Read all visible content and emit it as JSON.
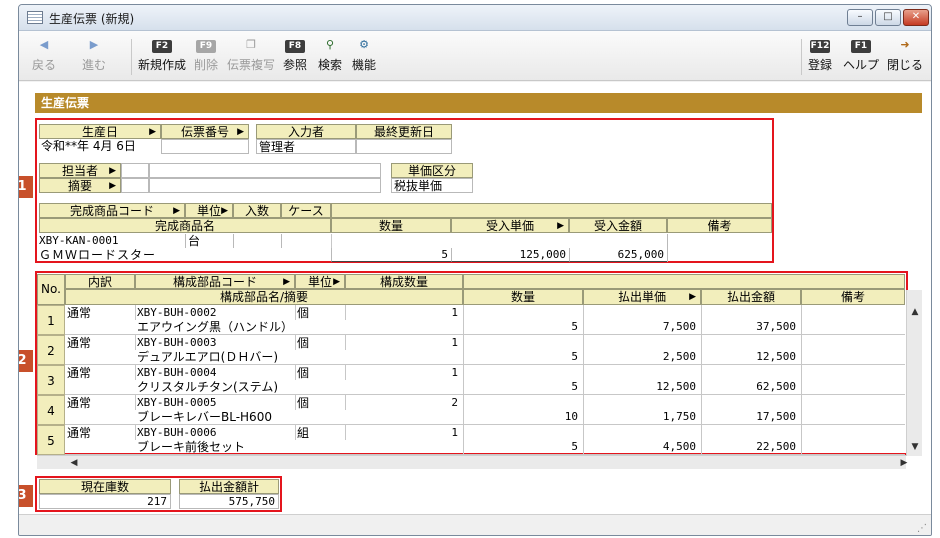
{
  "window": {
    "title": "生産伝票 (新規)",
    "min": "–",
    "max": "□",
    "close": "✕"
  },
  "toolbar": {
    "back": "戻る",
    "forward": "進む",
    "new": {
      "key": "F2",
      "label": "新規作成"
    },
    "delete": {
      "key": "F9",
      "label": "削除"
    },
    "copy": {
      "label": "伝票複写"
    },
    "ref": {
      "key": "F8",
      "label": "参照"
    },
    "search": {
      "label": "検索"
    },
    "func": {
      "label": "機能"
    },
    "register": {
      "key": "F12",
      "label": "登録"
    },
    "help": {
      "key": "F1",
      "label": "ヘルプ"
    },
    "close": {
      "label": "閉じる"
    }
  },
  "section": {
    "title": "生産伝票"
  },
  "header": {
    "date_label": "生産日",
    "slip_label": "伝票番号",
    "inputter_label": "入力者",
    "updated_label": "最終更新日",
    "date": "令和**年  4月  6日",
    "slip": "",
    "inputter": "管理者",
    "updated": "",
    "staff_label": "担当者",
    "memo_label": "摘要",
    "staff": "",
    "memo": "",
    "price_type_label": "単価区分",
    "price_type": "税抜単価"
  },
  "product": {
    "code_label": "完成商品コード",
    "unit_label": "単位",
    "qty_in_label": "入数",
    "case_label": "ケース",
    "name_label": "完成商品名",
    "qty_label": "数量",
    "unit_price_label": "受入単価",
    "amount_label": "受入金額",
    "note_label": "備考",
    "code": "XBY-KAN-0001",
    "unit": "台",
    "name": "ＧＭＷロードスター",
    "qty": "5",
    "unit_price": "125,000",
    "amount": "625,000"
  },
  "grid": {
    "no_label": "No.",
    "type_label": "内訳",
    "code_label": "構成部品コード",
    "unit_label": "単位",
    "comp_qty_label": "構成数量",
    "name_label": "構成部品名/摘要",
    "qty_label": "数量",
    "price_label": "払出単価",
    "amount_label": "払出金額",
    "note_label": "備考",
    "rows": [
      {
        "no": "1",
        "type": "通常",
        "code": "XBY-BUH-0002",
        "unit": "個",
        "comp_qty": "1",
        "name": "エアウイング黒（ハンドル）",
        "qty": "5",
        "price": "7,500",
        "amount": "37,500"
      },
      {
        "no": "2",
        "type": "通常",
        "code": "XBY-BUH-0003",
        "unit": "個",
        "comp_qty": "1",
        "name": "デュアルエアロ(ＤＨバー)",
        "qty": "5",
        "price": "2,500",
        "amount": "12,500"
      },
      {
        "no": "3",
        "type": "通常",
        "code": "XBY-BUH-0004",
        "unit": "個",
        "comp_qty": "1",
        "name": "クリスタルチタン(ステム)",
        "qty": "5",
        "price": "12,500",
        "amount": "62,500"
      },
      {
        "no": "4",
        "type": "通常",
        "code": "XBY-BUH-0005",
        "unit": "個",
        "comp_qty": "2",
        "name": "ブレーキレバーBL-H600",
        "qty": "10",
        "price": "1,750",
        "amount": "17,500"
      },
      {
        "no": "5",
        "type": "通常",
        "code": "XBY-BUH-0006",
        "unit": "組",
        "comp_qty": "1",
        "name": "ブレーキ前後セット",
        "qty": "5",
        "price": "4,500",
        "amount": "22,500"
      }
    ]
  },
  "totals": {
    "stock_label": "現在庫数",
    "stock": "217",
    "payout_label": "払出金額計",
    "payout": "575,750"
  },
  "badges": [
    "1",
    "2",
    "3"
  ]
}
